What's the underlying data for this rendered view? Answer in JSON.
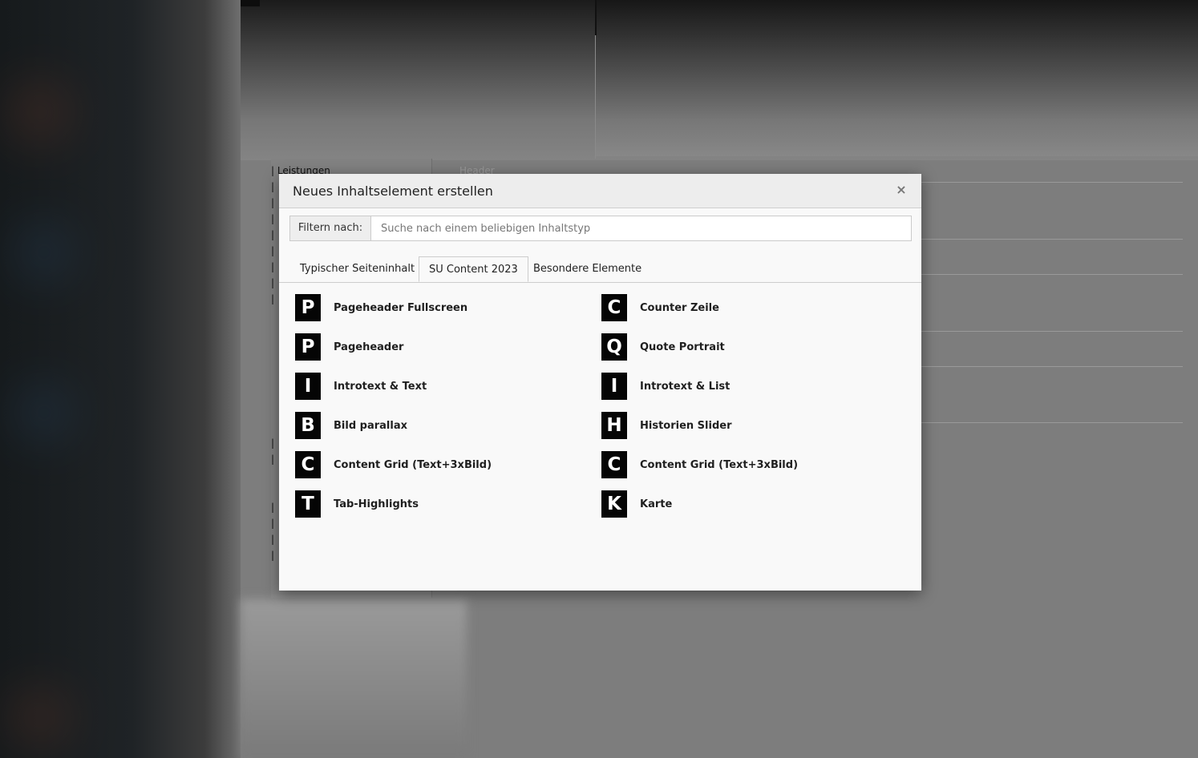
{
  "modal": {
    "title": "Neues Inhaltselement erstellen",
    "close_label": "×"
  },
  "filter": {
    "label": "Filtern nach:",
    "placeholder": "Suche nach einem beliebigen Inhaltstyp",
    "value": ""
  },
  "tabs": [
    {
      "label": "Typischer Seiteninhalt",
      "active": false
    },
    {
      "label": "SU Content 2023",
      "active": true
    },
    {
      "label": "Besondere Elemente",
      "active": false
    }
  ],
  "items_left": [
    {
      "icon": "P",
      "label": "Pageheader Fullscreen"
    },
    {
      "icon": "P",
      "label": "Pageheader"
    },
    {
      "icon": "I",
      "label": "Introtext & Text"
    },
    {
      "icon": "B",
      "label": "Bild parallax"
    },
    {
      "icon": "C",
      "label": "Content Grid (Text+3xBild)"
    },
    {
      "icon": "T",
      "label": "Tab-Highlights"
    }
  ],
  "items_right": [
    {
      "icon": "C",
      "label": "Counter Zeile"
    },
    {
      "icon": "Q",
      "label": "Quote Portrait"
    },
    {
      "icon": "I",
      "label": "Introtext & List"
    },
    {
      "icon": "H",
      "label": "Historien Slider"
    },
    {
      "icon": "C",
      "label": "Content Grid (Text+3xBild)"
    },
    {
      "icon": "K",
      "label": "Karte"
    }
  ],
  "background": {
    "tree_first_item": "Leistungen",
    "column_header": "Header"
  }
}
